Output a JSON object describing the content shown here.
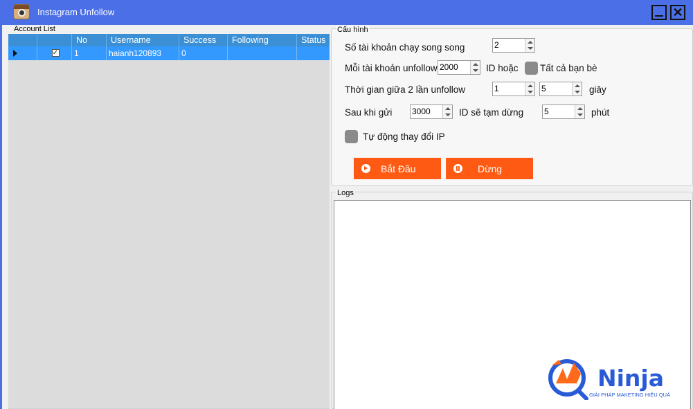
{
  "window": {
    "title": "Instagram Unfollow",
    "minimize_icon": "minimize-icon",
    "close_icon": "close-icon"
  },
  "account_list": {
    "label": "Account List",
    "columns": [
      "",
      "",
      "No",
      "Username",
      "Success",
      "Following",
      "Status"
    ],
    "rows": [
      {
        "selected": true,
        "checked": true,
        "no": "1",
        "username": "haianh120893",
        "success": "0",
        "following": "",
        "status": ""
      }
    ],
    "scrollbar_grip": "|||"
  },
  "config": {
    "label": "Cấu hình",
    "parallel_label": "Số tài khoản chạy song song",
    "parallel_value": "2",
    "per_account_label": "Mỗi tài khoản unfollow",
    "per_account_value": "2000",
    "id_or_label": "ID hoặc",
    "all_friends_label": "Tất cả bạn bè",
    "interval_label": "Thời gian giữa 2 lần unfollow",
    "interval_min": "1",
    "interval_max": "5",
    "seconds_label": "giây",
    "after_send_label": "Sau khi gửi",
    "after_send_value": "3000",
    "pause_label": "ID sẽ tạm dừng",
    "pause_minutes": "5",
    "minutes_label": "phút",
    "auto_ip_label": "Tự động thay đổi IP",
    "start_button": "Bắt Đầu",
    "stop_button": "Dừng",
    "accent_color": "#ff5a13"
  },
  "logs": {
    "label": "Logs"
  },
  "branding": {
    "logo_word": "Ninja",
    "tagline": "GIẢI PHÁP MAKETING HIỆU QUẢ"
  }
}
